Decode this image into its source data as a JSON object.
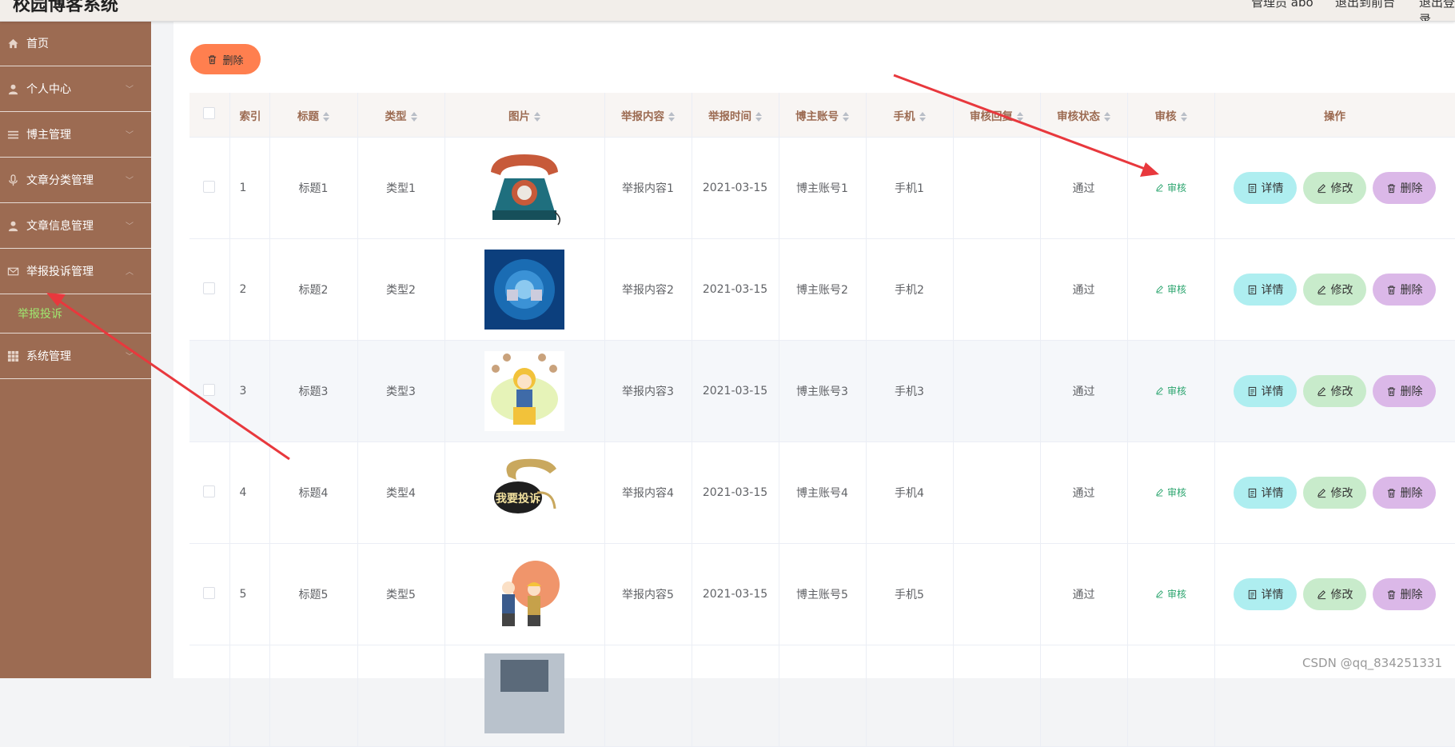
{
  "header": {
    "app_title": "校园博客系统",
    "user_label": "管理员 abo",
    "to_front": "退出到前台",
    "logout": "退出登录"
  },
  "sidebar": {
    "items": [
      {
        "label": "首页",
        "icon": "home-icon"
      },
      {
        "label": "个人中心",
        "icon": "user-icon"
      },
      {
        "label": "博主管理",
        "icon": "list-icon"
      },
      {
        "label": "文章分类管理",
        "icon": "microphone-icon"
      },
      {
        "label": "文章信息管理",
        "icon": "user-icon"
      },
      {
        "label": "举报投诉管理",
        "icon": "mail-icon",
        "expanded": true
      },
      {
        "label": "系统管理",
        "icon": "grid-icon"
      }
    ],
    "submenu": {
      "label": "举报投诉",
      "active": true
    }
  },
  "toolbar": {
    "bulk_delete_label": "删除"
  },
  "table": {
    "headers": {
      "index": "索引",
      "title": "标题",
      "type": "类型",
      "image": "图片",
      "content": "举报内容",
      "time": "举报时间",
      "account": "博主账号",
      "phone": "手机",
      "reply": "审核回复",
      "status": "审核状态",
      "audit": "审核",
      "actions": "操作"
    },
    "rows": [
      {
        "index": "1",
        "title": "标题1",
        "type": "类型1",
        "content": "举报内容1",
        "time": "2021-03-15",
        "account": "博主账号1",
        "phone": "手机1",
        "reply": "",
        "status": "通过",
        "audit": "审核"
      },
      {
        "index": "2",
        "title": "标题2",
        "type": "类型2",
        "content": "举报内容2",
        "time": "2021-03-15",
        "account": "博主账号2",
        "phone": "手机2",
        "reply": "",
        "status": "通过",
        "audit": "审核"
      },
      {
        "index": "3",
        "title": "标题3",
        "type": "类型3",
        "content": "举报内容3",
        "time": "2021-03-15",
        "account": "博主账号3",
        "phone": "手机3",
        "reply": "",
        "status": "通过",
        "audit": "审核"
      },
      {
        "index": "4",
        "title": "标题4",
        "type": "类型4",
        "content": "举报内容4",
        "time": "2021-03-15",
        "account": "博主账号4",
        "phone": "手机4",
        "reply": "",
        "status": "通过",
        "audit": "审核"
      },
      {
        "index": "5",
        "title": "标题5",
        "type": "类型5",
        "content": "举报内容5",
        "time": "2021-03-15",
        "account": "博主账号5",
        "phone": "手机5",
        "reply": "",
        "status": "通过",
        "audit": "审核"
      }
    ],
    "row_actions": {
      "detail": "详情",
      "edit": "修改",
      "delete": "删除"
    },
    "thumb4_text": "我要投诉"
  },
  "colors": {
    "sidebar_bg": "#9c6b52",
    "active_submenu": "#9fe870",
    "header_text": "#9c6b52",
    "bulk_delete": "#ff7f4f",
    "detail_btn": "#aeeef0",
    "edit_btn": "#c8ebcb",
    "delete_btn": "#dbb8e8",
    "audit_link": "#2ca56f",
    "arrow": "#e8383d"
  },
  "watermark": "CSDN @qq_834251331"
}
